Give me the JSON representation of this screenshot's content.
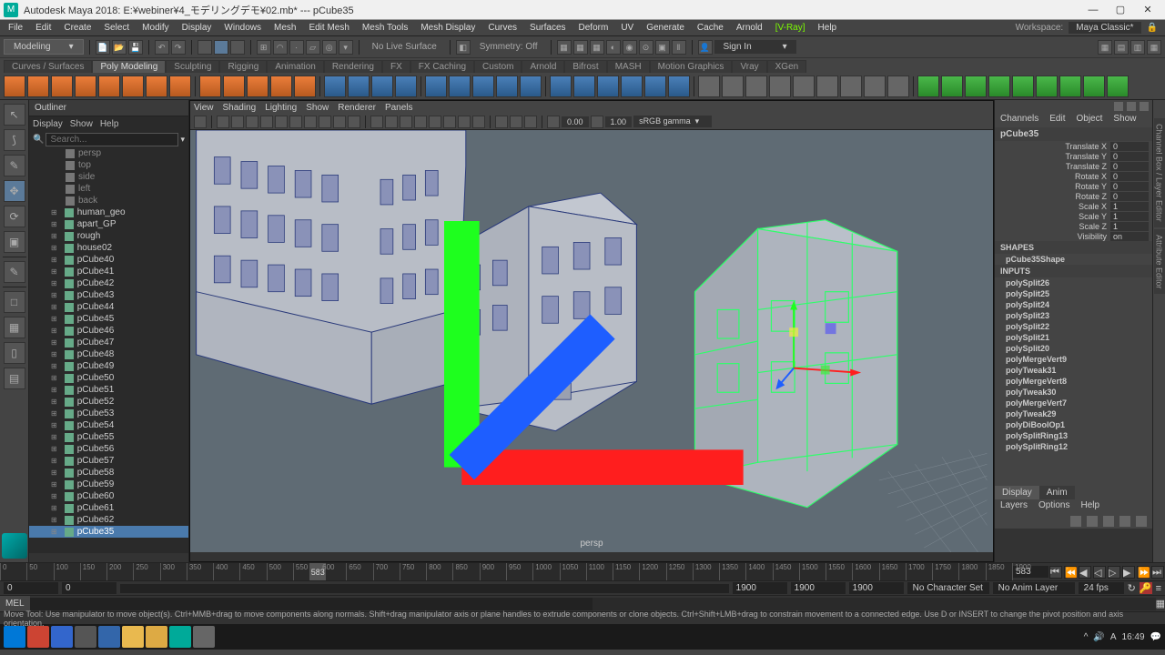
{
  "window": {
    "title": "Autodesk Maya 2018: E:¥webiner¥4_モデリングデモ¥02.mb*   ---   pCube35",
    "workspace_label": "Workspace:",
    "workspace_value": "Maya Classic*"
  },
  "menu": [
    "File",
    "Edit",
    "Create",
    "Select",
    "Modify",
    "Display",
    "Windows",
    "Mesh",
    "Edit Mesh",
    "Mesh Tools",
    "Mesh Display",
    "Curves",
    "Surfaces",
    "Deform",
    "UV",
    "Generate",
    "Cache",
    "Arnold",
    "[V-Ray]",
    "Help"
  ],
  "module": "Modeling",
  "status": {
    "surface": "No Live Surface",
    "symmetry": "Symmetry: Off",
    "signin": "Sign In"
  },
  "shelftabs": [
    "Curves / Surfaces",
    "Poly Modeling",
    "Sculpting",
    "Rigging",
    "Animation",
    "Rendering",
    "FX",
    "FX Caching",
    "Custom",
    "Arnold",
    "Bifrost",
    "MASH",
    "Motion Graphics",
    "Vray",
    "XGen"
  ],
  "shelftab_active": 1,
  "outliner": {
    "title": "Outliner",
    "menu": [
      "Display",
      "Show",
      "Help"
    ],
    "search_placeholder": "Search...",
    "cameras": [
      "persp",
      "top",
      "side",
      "left",
      "back"
    ],
    "items": [
      "human_geo",
      "apart_GP",
      "rough",
      "house02",
      "pCube40",
      "pCube41",
      "pCube42",
      "pCube43",
      "pCube44",
      "pCube45",
      "pCube46",
      "pCube47",
      "pCube48",
      "pCube49",
      "pCube50",
      "pCube51",
      "pCube52",
      "pCube53",
      "pCube54",
      "pCube55",
      "pCube56",
      "pCube57",
      "pCube58",
      "pCube59",
      "pCube60",
      "pCube61",
      "pCube62",
      "pCube35"
    ],
    "selected": "pCube35"
  },
  "viewport": {
    "menu": [
      "View",
      "Shading",
      "Lighting",
      "Show",
      "Renderer",
      "Panels"
    ],
    "exposure": "0.00",
    "gamma": "1.00",
    "colorspace": "sRGB gamma",
    "camera": "persp"
  },
  "channels": {
    "tabs": [
      "Channels",
      "Edit",
      "Object",
      "Show"
    ],
    "object": "pCube35",
    "attrs": [
      {
        "n": "Translate X",
        "v": "0"
      },
      {
        "n": "Translate Y",
        "v": "0"
      },
      {
        "n": "Translate Z",
        "v": "0"
      },
      {
        "n": "Rotate X",
        "v": "0"
      },
      {
        "n": "Rotate Y",
        "v": "0"
      },
      {
        "n": "Rotate Z",
        "v": "0"
      },
      {
        "n": "Scale X",
        "v": "1"
      },
      {
        "n": "Scale Y",
        "v": "1"
      },
      {
        "n": "Scale Z",
        "v": "1"
      },
      {
        "n": "Visibility",
        "v": "on"
      }
    ],
    "shapes_label": "SHAPES",
    "shape": "pCube35Shape",
    "inputs_label": "INPUTS",
    "inputs": [
      "polySplit26",
      "polySplit25",
      "polySplit24",
      "polySplit23",
      "polySplit22",
      "polySplit21",
      "polySplit20",
      "polyMergeVert9",
      "polyTweak31",
      "polyMergeVert8",
      "polyTweak30",
      "polyMergeVert7",
      "polyTweak29",
      "polyDiBoolOp1",
      "polySplitRing13",
      "polySplitRing12"
    ]
  },
  "layers": {
    "tabs": [
      "Display",
      "Anim"
    ],
    "menu": [
      "Layers",
      "Options",
      "Help"
    ]
  },
  "timeline": {
    "current": "583",
    "start": "0",
    "in": "0",
    "out": "1900",
    "end": "1900",
    "end2": "1900",
    "charset": "No Character Set",
    "animlayer": "No Anim Layer",
    "fps": "24 fps",
    "ticks": [
      "0",
      "50",
      "100",
      "150",
      "200",
      "250",
      "300",
      "350",
      "400",
      "450",
      "500",
      "550",
      "600",
      "650",
      "700",
      "750",
      "800",
      "850",
      "900",
      "950",
      "1000",
      "1050",
      "1100",
      "1150",
      "1200",
      "1250",
      "1300",
      "1350",
      "1400",
      "1450",
      "1500",
      "1550",
      "1600",
      "1650",
      "1700",
      "1750",
      "1800",
      "1850",
      "1900"
    ]
  },
  "mel": "MEL",
  "helpline": "Move Tool: Use manipulator to move object(s). Ctrl+MMB+drag to move components along normals. Shift+drag manipulator axis or plane handles to extrude components or clone objects. Ctrl+Shift+LMB+drag to constrain movement to a connected edge. Use D or INSERT to change the pivot position and axis orientation.",
  "system": {
    "time": "16:49"
  }
}
